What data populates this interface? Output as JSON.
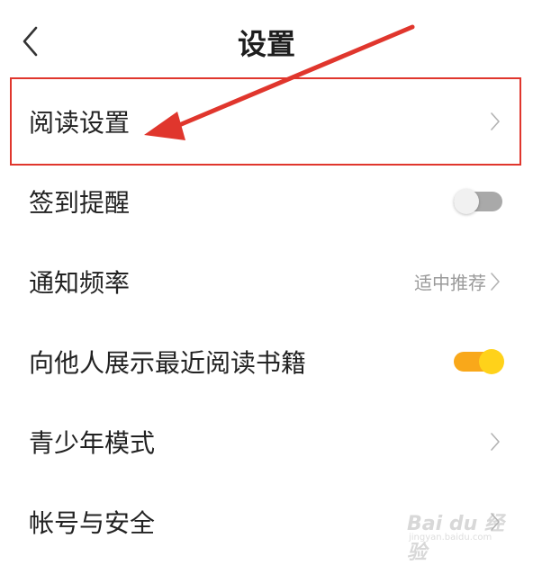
{
  "header": {
    "title": "设置",
    "back_icon": "chevron-left-icon"
  },
  "settings": {
    "items": [
      {
        "label": "阅读设置",
        "control": "chevron",
        "icon": "chevron-right-icon"
      },
      {
        "label": "签到提醒",
        "control": "toggle",
        "toggle_on": false
      },
      {
        "label": "通知频率",
        "control": "chevron",
        "value": "适中推荐",
        "icon": "chevron-right-icon"
      },
      {
        "label": "向他人展示最近阅读书籍",
        "control": "toggle",
        "toggle_on": true
      },
      {
        "label": "青少年模式",
        "control": "chevron",
        "icon": "chevron-right-icon"
      },
      {
        "label": "帐号与安全",
        "control": "chevron",
        "icon": "chevron-right-icon"
      }
    ]
  },
  "annotation": {
    "highlight_color": "#e0362d",
    "arrow_color": "#e0362d"
  },
  "colors": {
    "toggle_on_track": "#f9a81a",
    "toggle_on_knob": "#ffd21a",
    "toggle_off_track": "#a9a9a9",
    "secondary_text": "#9a9a9a"
  },
  "watermark": {
    "main": "Bai du 经验",
    "sub": "jingyan.baidu.com"
  }
}
